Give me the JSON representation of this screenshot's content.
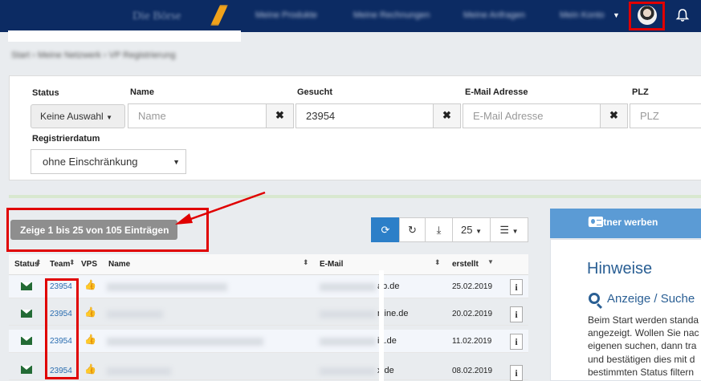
{
  "nav": {
    "brand": "Die Börse",
    "items": [
      "Meine Produkte",
      "Meine Rechnungen",
      "Meine Anfragen",
      "Mein Konto"
    ]
  },
  "breadcrumb": "Start › Meine Netzwerk › VP Registrierung",
  "filters": {
    "status_label": "Status",
    "status_value": "Keine Auswahl",
    "name_label": "Name",
    "name_placeholder": "Name",
    "search_label": "Gesucht",
    "search_value": "23954",
    "email_label": "E-Mail Adresse",
    "email_placeholder": "E-Mail Adresse",
    "plz_label": "PLZ",
    "plz_placeholder": "PLZ",
    "regdate_label": "Registrierdatum",
    "regdate_value": "ohne Einschränkung",
    "clear_symbol": "✖"
  },
  "count_text": "Zeige 1 bis 25 von 105 Einträgen",
  "toolbar": {
    "page_size": "25"
  },
  "table": {
    "headers": {
      "status": "Status",
      "team": "Team",
      "vps": "VPS",
      "name": "Name",
      "email": "E-Mail",
      "created": "erstellt"
    },
    "rows": [
      {
        "team": "23954",
        "email_tail": "ab.de",
        "date": "25.02.2019"
      },
      {
        "team": "23954",
        "email_tail": "nline.de",
        "date": "20.02.2019"
      },
      {
        "team": "23954",
        "email_tail": "ia.de",
        "date": "11.02.2019"
      },
      {
        "team": "23954",
        "email_tail": "x.de",
        "date": "08.02.2019"
      }
    ]
  },
  "sidebar": {
    "partner_button": "Partner werben",
    "hint_title": "Hinweise",
    "hint_subtitle": "Anzeige / Suche",
    "hint_lines": [
      "Beim Start werden standa",
      "angezeigt. Wollen Sie nac",
      "eigenen suchen, dann tra",
      "und bestätigen dies mit d",
      "bestimmten Status filtern"
    ]
  },
  "colors": {
    "navbar": "#0c2b63",
    "primary": "#2c7fc8",
    "highlight": "#e00000",
    "link": "#2a6db0"
  }
}
